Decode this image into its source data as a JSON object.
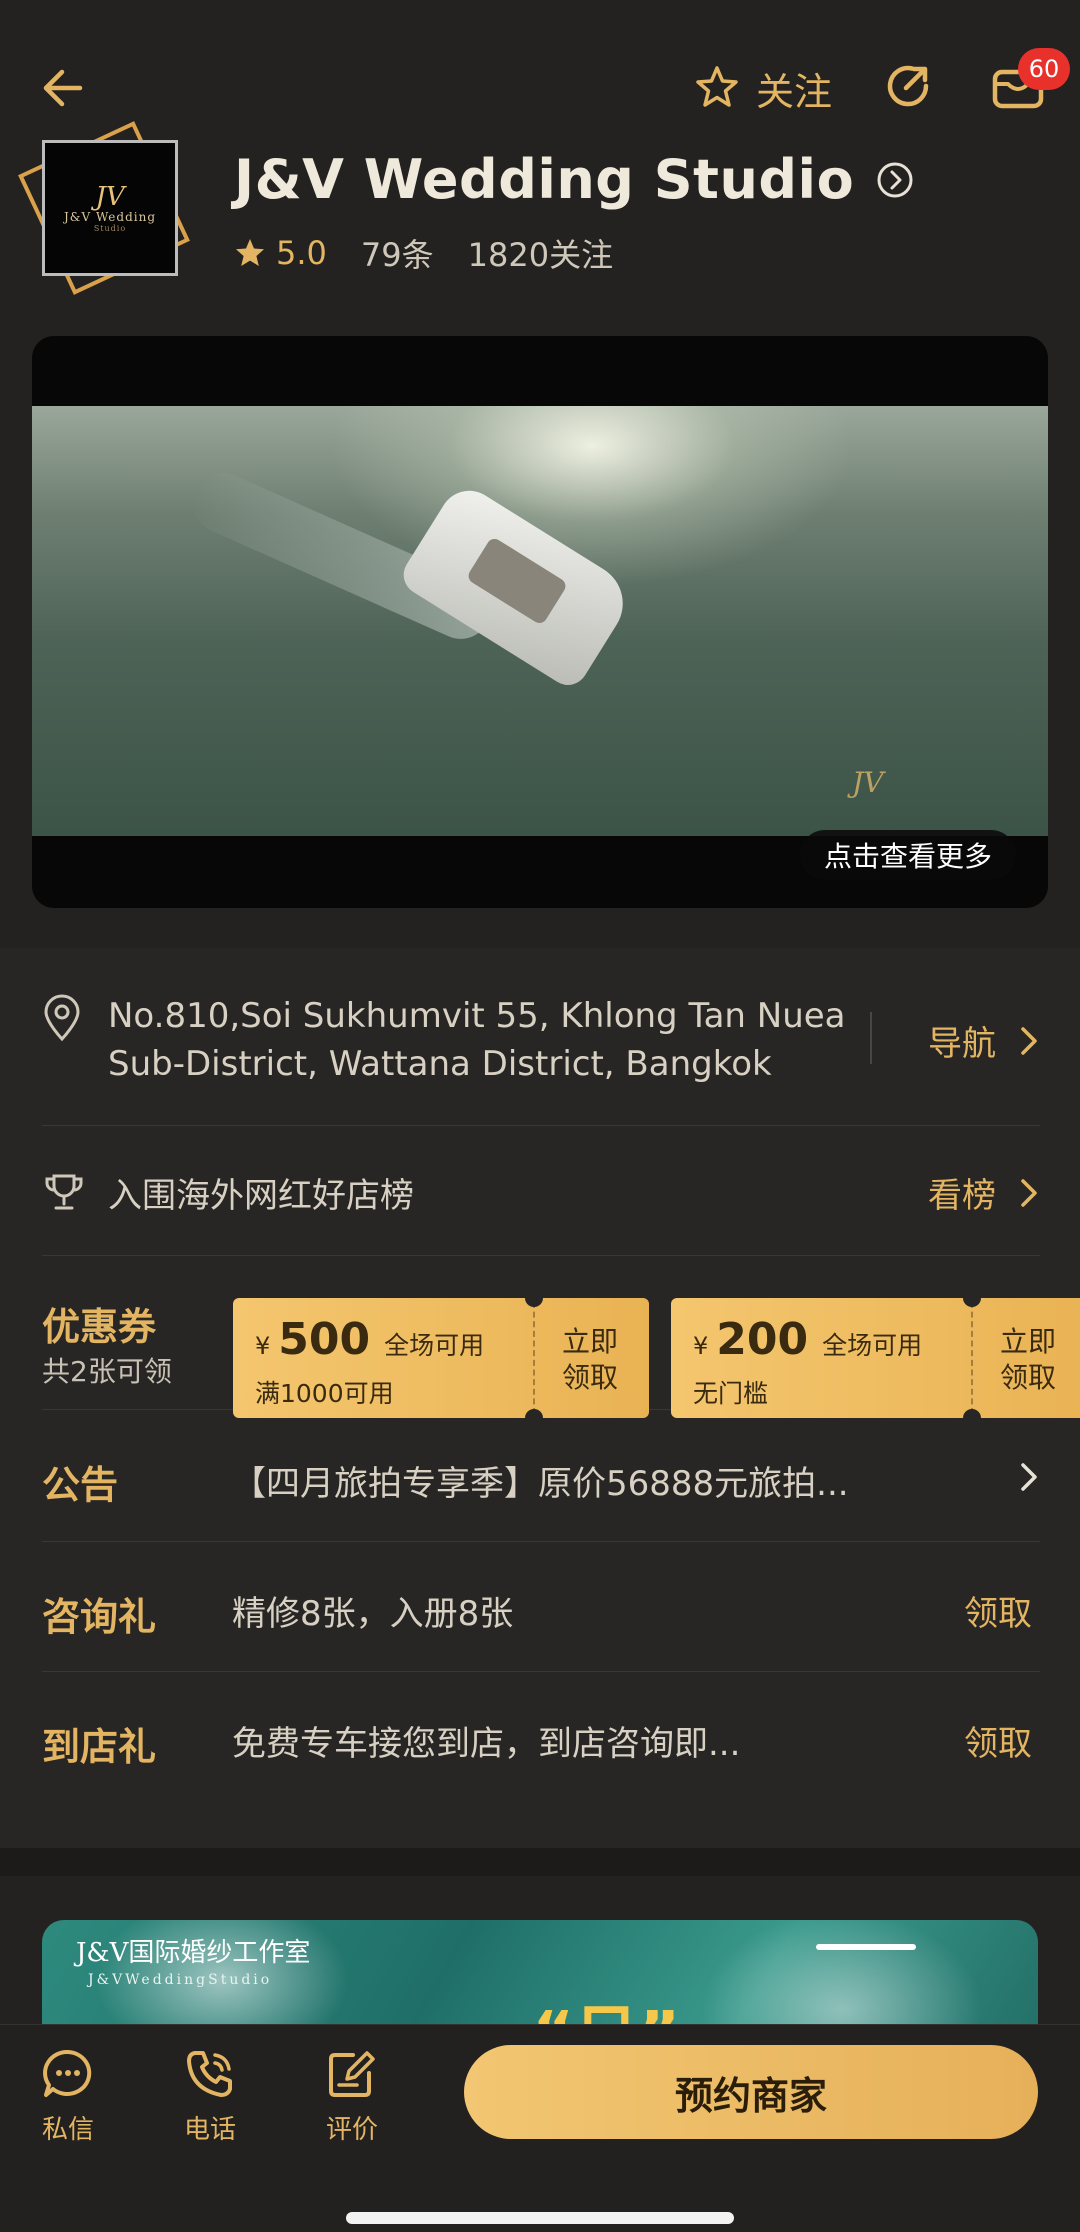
{
  "topbar": {
    "follow_label": "关注",
    "badge_count": "60"
  },
  "header": {
    "logo_text": "J&V Wedding",
    "logo_sub": "Studio",
    "title": "J&V Wedding Studio",
    "rating": "5.0",
    "reviews": "79条",
    "followers": "1820关注"
  },
  "media": {
    "watermark": "JV",
    "more_label": "点击查看更多"
  },
  "address": {
    "line1": "No.810,Soi Sukhumvit 55, Khlong Tan Nuea",
    "line2": "Sub-District, Wattana District, Bangkok",
    "nav_label": "导航"
  },
  "ranking": {
    "text": "入围海外网红好店榜",
    "link_label": "看榜"
  },
  "coupons": {
    "title": "优惠券",
    "count_text": "共2张可领",
    "items": [
      {
        "symbol": "¥",
        "amount": "500",
        "scope": "全场可用",
        "condition": "满1000可用",
        "claim_line1": "立即",
        "claim_line2": "领取"
      },
      {
        "symbol": "¥",
        "amount": "200",
        "scope": "全场可用",
        "condition": "无门槛",
        "claim_line1": "立即",
        "claim_line2": "领取"
      }
    ]
  },
  "notice": {
    "label": "公告",
    "text": "【四月旅拍专享季】原价56888元旅拍..."
  },
  "consult_gift": {
    "label": "咨询礼",
    "text": "精修8张，入册8张",
    "claim": "领取"
  },
  "store_gift": {
    "label": "到店礼",
    "text": "免费专车接您到店，到店咨询即...",
    "claim": "领取"
  },
  "banner": {
    "title": "J&V国际婚纱工作室",
    "subtitle": "J&VWeddingStudio",
    "quote": "“日”"
  },
  "bottombar": {
    "message_label": "私信",
    "phone_label": "电话",
    "review_label": "评价",
    "book_label": "预约商家"
  },
  "colors": {
    "background": "#242220",
    "accent_gold": "#e3b562",
    "badge_red": "#e8312b"
  }
}
